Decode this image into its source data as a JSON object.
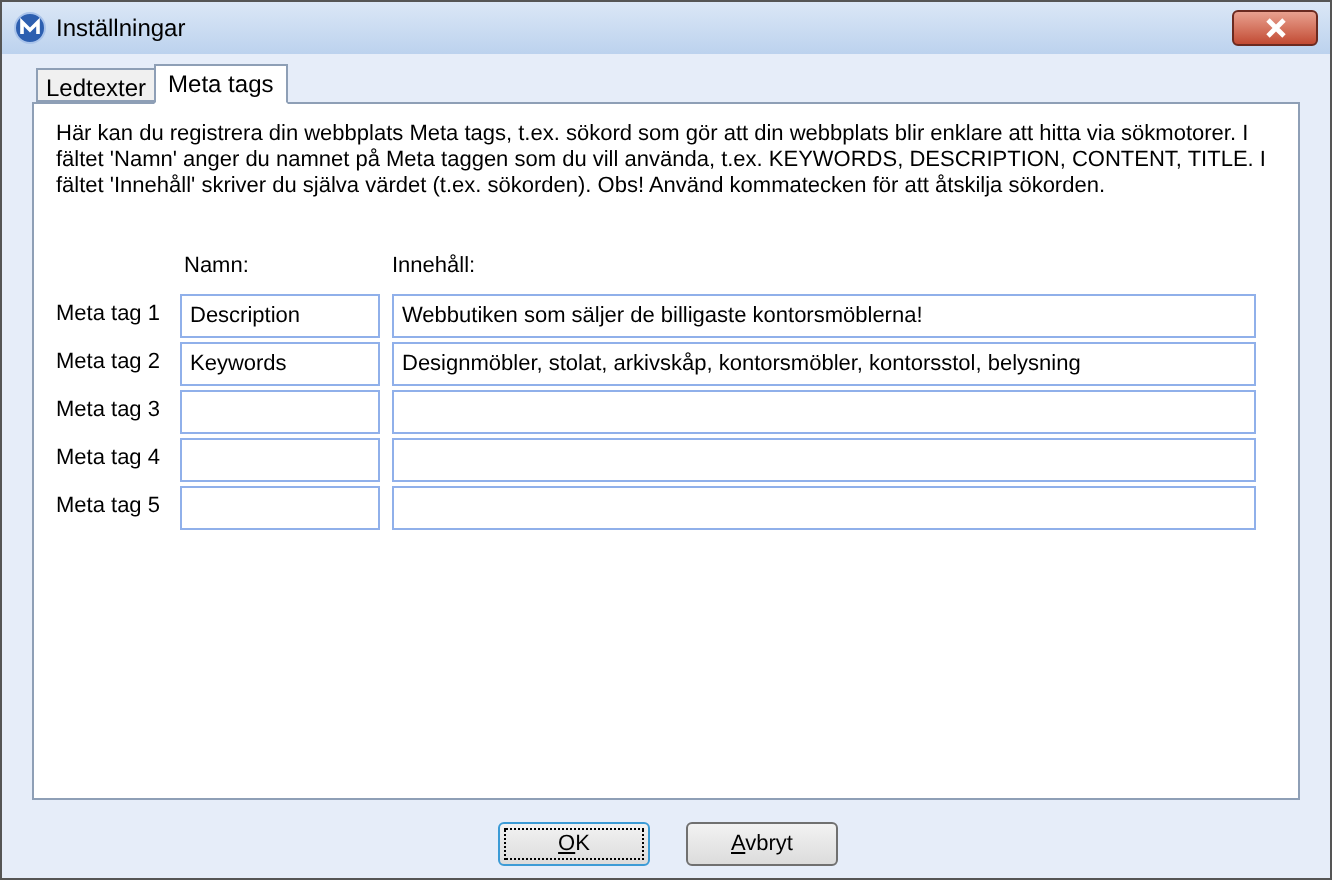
{
  "window": {
    "title": "Inställningar"
  },
  "tabs": [
    {
      "label": "Ledtexter",
      "selected": false
    },
    {
      "label": "Meta tags",
      "selected": true
    }
  ],
  "description": "Här kan du registrera din webbplats Meta tags, t.ex. sökord som gör att din webbplats blir enklare att hitta via sökmotorer. I fältet 'Namn' anger du namnet på Meta taggen som du vill använda, t.ex. KEYWORDS, DESCRIPTION, CONTENT, TITLE. I fältet 'Innehåll' skriver du själva värdet (t.ex. sökorden). Obs! Använd kommatecken för att åtskilja sökorden.",
  "columns": {
    "name": "Namn:",
    "content": "Innehåll:"
  },
  "rows": [
    {
      "label": "Meta tag 1",
      "name": "Description",
      "content": "Webbutiken som säljer de billigaste kontorsmöblerna!"
    },
    {
      "label": "Meta tag 2",
      "name": "Keywords",
      "content": "Designmöbler, stolat, arkivskåp, kontorsmöbler, kontorsstol, belysning"
    },
    {
      "label": "Meta tag 3"
    },
    {
      "label": "Meta tag 4"
    },
    {
      "label": "Meta tag 5"
    }
  ],
  "buttons": [
    {
      "label": "OK",
      "default": true
    },
    {
      "label": "Avbryt",
      "default": false
    }
  ]
}
